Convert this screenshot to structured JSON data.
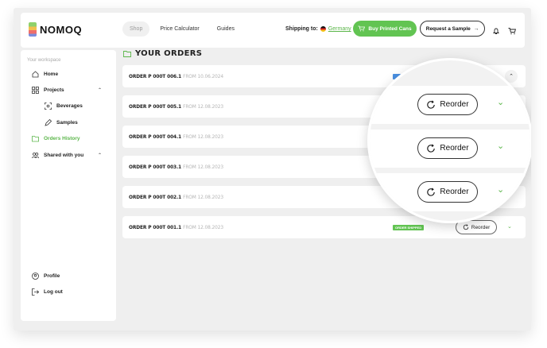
{
  "header": {
    "logo_text": "NOMOQ",
    "nav": [
      "Shop",
      "Price Calculator",
      "Guides"
    ],
    "shipping_label": "Shipping to:",
    "shipping_country": "Germany",
    "buy_button": "Buy Printed Cans",
    "sample_button": "Request a Sample"
  },
  "sidebar": {
    "workspace_label": "Your workspace",
    "items": [
      {
        "label": "Home",
        "icon": "home-icon"
      },
      {
        "label": "Projects",
        "icon": "grid-icon"
      },
      {
        "label": "Beverages",
        "icon": "target-icon"
      },
      {
        "label": "Samples",
        "icon": "pen-icon"
      },
      {
        "label": "Orders History",
        "icon": "folder-icon"
      },
      {
        "label": "Shared with you",
        "icon": "users-icon"
      }
    ],
    "profile": "Profile",
    "logout": "Log out"
  },
  "main": {
    "title": "YOUR ORDERS",
    "orders": [
      {
        "id": "ORDER P 000T 006.1",
        "date": "FROM 10.06.2024",
        "badge": "",
        "reorder": "",
        "state": "expanded"
      },
      {
        "id": "ORDER P 000T 005.1",
        "date": "FROM 12.08.2023",
        "badge": "",
        "reorder": "Reorder"
      },
      {
        "id": "ORDER P 000T 004.1",
        "date": "FROM 12.08.2023",
        "badge": "",
        "reorder": "Reorder"
      },
      {
        "id": "ORDER P 000T 003.1",
        "date": "FROM 12.08.2023",
        "badge": "",
        "reorder": "Reorder"
      },
      {
        "id": "ORDER P 000T 002.1",
        "date": "FROM 12.08.2023",
        "badge": "",
        "reorder": ""
      },
      {
        "id": "ORDER P 000T 001.1",
        "date": "FROM 12.08.2023",
        "badge": "ORDER SHIPPED",
        "reorder": "Reorder"
      }
    ],
    "magnified_reorder": "Reorder"
  },
  "colors": {
    "accent": "#62c452",
    "background": "#efefef",
    "card": "#ffffff"
  }
}
